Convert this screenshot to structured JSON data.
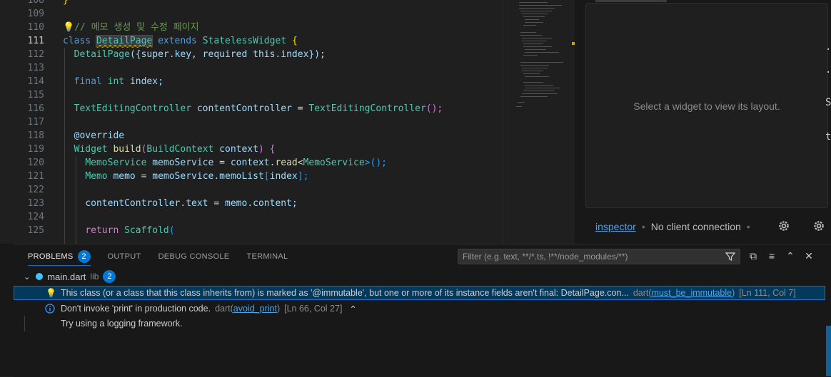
{
  "editor": {
    "line_numbers": [
      "108",
      "109",
      "110",
      "111",
      "112",
      "113",
      "114",
      "115",
      "116",
      "117",
      "118",
      "119",
      "120",
      "121",
      "122",
      "123",
      "124",
      "125"
    ],
    "active_line": "111",
    "lines": {
      "l108": "}",
      "l110_comment": "// 메모 생성 및 수정 페이지",
      "l111": {
        "kw": "class",
        "name": "DetailPage",
        "ext": "extends",
        "base": "StatelessWidget",
        "brace": "{"
      },
      "l112": {
        "ctor": "DetailPage",
        "args": "({super.key, required this.index});"
      },
      "l114": {
        "kw1": "final",
        "kw2": "int",
        "var": "index;"
      },
      "l116": {
        "type": "TextEditingController",
        "var": "contentController",
        "eq": "=",
        "ctor": "TextEditingController",
        "end": "();"
      },
      "l118": "@override",
      "l119": {
        "type": "Widget",
        "fn": "build",
        "ptype": "BuildContext",
        "pvar": "context",
        "end": ") {"
      },
      "l120": {
        "type": "MemoService",
        "var": "memoService",
        "eq": "=",
        "obj": "context",
        "m": "read",
        "gen": "MemoService",
        "end": ">();"
      },
      "l121": {
        "type": "Memo",
        "var": "memo",
        "eq": "=",
        "obj": "memoService",
        "prop": "memoList",
        "idx": "index",
        "end": "];"
      },
      "l123": {
        "obj": "contentController",
        "prop": "text",
        "eq": "=",
        "src": "memo",
        "srcp": "content;"
      },
      "l125": {
        "kw": "return",
        "fn": "Scaffold",
        "open": "("
      }
    }
  },
  "inspector": {
    "placeholder": "Select a widget to view its layout.",
    "tab_label": "inspector",
    "status": "No client connection"
  },
  "edge_chars": [
    ".",
    ".",
    "S",
    "t"
  ],
  "panel": {
    "tabs": [
      {
        "label": "PROBLEMS",
        "badge": "2"
      },
      {
        "label": "OUTPUT"
      },
      {
        "label": "DEBUG CONSOLE"
      },
      {
        "label": "TERMINAL"
      }
    ],
    "filter_placeholder": "Filter (e.g. text, **/*.ts, !**/node_modules/**)",
    "file": {
      "name": "main.dart",
      "path": "lib",
      "count": "2"
    },
    "problems": [
      {
        "message": "This class (or a class that this class inherits from) is marked as '@immutable', but one or more of its instance fields aren't final: DetailPage.con...",
        "source": "dart",
        "rule": "must_be_immutable",
        "location": "[Ln 111, Col 7]"
      },
      {
        "message": "Don't invoke 'print' in production code.",
        "source": "dart",
        "rule": "avoid_print",
        "location": "[Ln 66, Col 27]",
        "hint": "Try using a logging framework."
      }
    ]
  },
  "colors": {
    "accent": "#0078d4",
    "warning": "#cca700",
    "info": "#3794ff"
  }
}
